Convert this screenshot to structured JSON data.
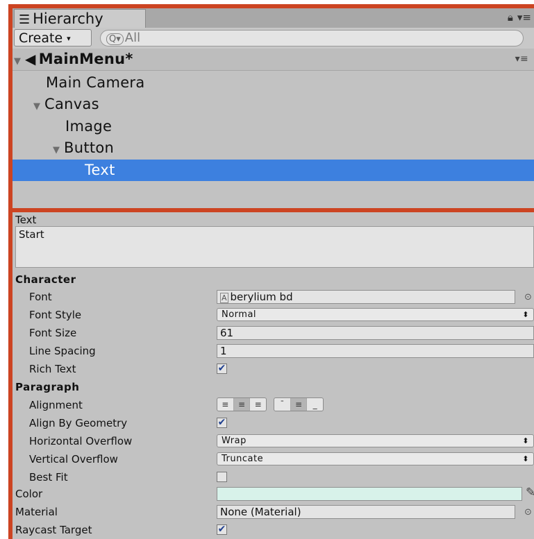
{
  "hierarchy": {
    "tab_title": "Hierarchy",
    "tab_icon": "list-icon",
    "create_label": "Create",
    "search_placeholder": "All",
    "scene_name": "MainMenu*",
    "items": [
      {
        "label": "Main Camera",
        "depth": 1,
        "expanded": null
      },
      {
        "label": "Canvas",
        "depth": 1,
        "expanded": true
      },
      {
        "label": "Image",
        "depth": 2,
        "expanded": null
      },
      {
        "label": "Button",
        "depth": 2,
        "expanded": true
      },
      {
        "label": "Text",
        "depth": 3,
        "expanded": null,
        "selected": true
      }
    ],
    "selection_color": "#3d80df"
  },
  "inspector": {
    "text_label": "Text",
    "text_value": "Start",
    "character_heading": "Character",
    "font_label": "Font",
    "font_value": "berylium bd",
    "font_style_label": "Font Style",
    "font_style_value": "Normal",
    "font_size_label": "Font Size",
    "font_size_value": "61",
    "line_spacing_label": "Line Spacing",
    "line_spacing_value": "1",
    "rich_text_label": "Rich Text",
    "rich_text_checked": true,
    "paragraph_heading": "Paragraph",
    "alignment_label": "Alignment",
    "horizontal_alignment_selected": "center",
    "vertical_alignment_selected": "middle",
    "align_by_geometry_label": "Align By Geometry",
    "align_by_geometry_checked": true,
    "horizontal_overflow_label": "Horizontal Overflow",
    "horizontal_overflow_value": "Wrap",
    "vertical_overflow_label": "Vertical Overflow",
    "vertical_overflow_value": "Truncate",
    "best_fit_label": "Best Fit",
    "best_fit_checked": false,
    "color_label": "Color",
    "color_value": "#d8f2ea",
    "material_label": "Material",
    "material_value": "None (Material)",
    "raycast_target_label": "Raycast Target",
    "raycast_target_checked": true
  },
  "accent_border_color": "#cc4422"
}
